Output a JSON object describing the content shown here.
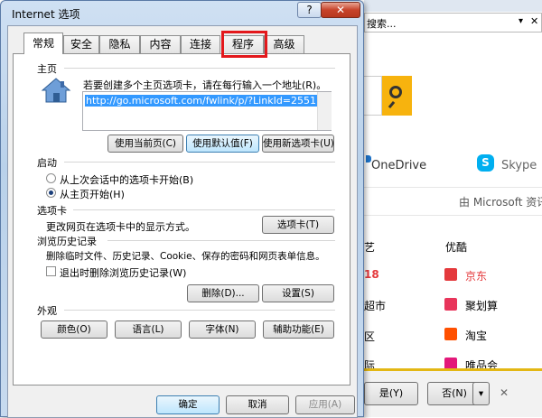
{
  "browser": {
    "search_placeholder": "搜索...",
    "onedrive": "OneDrive",
    "skype": "Skype",
    "microsoft_info": "由 Microsoft 资讯",
    "col_left": [
      "艺",
      "18",
      "超市",
      "区",
      "际"
    ],
    "col_right_title": "优酷",
    "col_right": [
      "京东",
      "聚划算",
      "淘宝",
      "唯品会"
    ],
    "notif_yes": "是(Y)",
    "notif_no": "否(N)"
  },
  "dialog": {
    "title": "Internet 选项",
    "help": "?",
    "close": "✕",
    "tabs": [
      "常规",
      "安全",
      "隐私",
      "内容",
      "连接",
      "程序",
      "高级"
    ],
    "homepage": {
      "section": "主页",
      "hint": "若要创建多个主页选项卡，请在每行输入一个地址(R)。",
      "value": "http://go.microsoft.com/fwlink/p/?LinkId=2551",
      "btn_current": "使用当前页(C)",
      "btn_default": "使用默认值(F)",
      "btn_newtab": "使用新选项卡(U)"
    },
    "startup": {
      "section": "启动",
      "opt_last": "从上次会话中的选项卡开始(B)",
      "opt_home": "从主页开始(H)"
    },
    "tabs_section": {
      "section": "选项卡",
      "desc": "更改网页在选项卡中的显示方式。",
      "btn": "选项卡(T)"
    },
    "history": {
      "section": "浏览历史记录",
      "desc": "删除临时文件、历史记录、Cookie、保存的密码和网页表单信息。",
      "checkbox": "退出时删除浏览历史记录(W)",
      "btn_delete": "删除(D)...",
      "btn_settings": "设置(S)"
    },
    "appearance": {
      "section": "外观",
      "btn_colors": "颜色(O)",
      "btn_languages": "语言(L)",
      "btn_fonts": "字体(N)",
      "btn_access": "辅助功能(E)"
    },
    "footer": {
      "ok": "确定",
      "cancel": "取消",
      "apply": "应用(A)"
    }
  },
  "colors": {
    "highlight": "#e3181c",
    "search_button": "#f7b30e",
    "skype": "#00aff0",
    "jd": "#e4393c"
  }
}
